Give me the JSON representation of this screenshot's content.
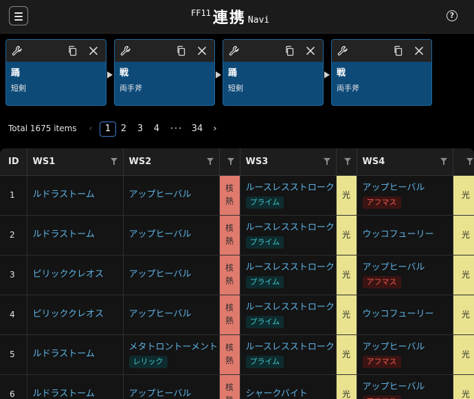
{
  "header": {
    "title_small": "FF11",
    "title_main": "連携",
    "title_suffix": "Navi",
    "menu_icon": "hamburger-icon",
    "help_icon": "help-circle-icon"
  },
  "cards": [
    {
      "main": "踊",
      "sub": "短剣"
    },
    {
      "main": "戦",
      "sub": "両手斧"
    },
    {
      "main": "踊",
      "sub": "短剣"
    },
    {
      "main": "戦",
      "sub": "両手斧"
    }
  ],
  "pagination": {
    "total": "Total 1675 items",
    "prev": "‹",
    "pages": [
      "1",
      "2",
      "3",
      "4"
    ],
    "ellipsis": "•••",
    "last": "34",
    "next": "›",
    "current": "1"
  },
  "table": {
    "headers": [
      "ID",
      "WS1",
      "WS2",
      "",
      "WS3",
      "",
      "WS4",
      ""
    ],
    "rows": [
      {
        "id": "1",
        "ws1": "ルドラストーム",
        "ws2": "アップヒーバル",
        "ws2_tag": "",
        "sc1": "核熱",
        "ws3": "ルースレスストローク",
        "ws3_tag": "プライム",
        "sc2": "光",
        "ws4": "アップヒーバル",
        "ws4_tag": "アフマス",
        "sc3": "光"
      },
      {
        "id": "2",
        "ws1": "ルドラストーム",
        "ws2": "アップヒーバル",
        "ws2_tag": "",
        "sc1": "核熱",
        "ws3": "ルースレスストローク",
        "ws3_tag": "プライム",
        "sc2": "光",
        "ws4": "ウッコフューリー",
        "ws4_tag": "",
        "sc3": "光"
      },
      {
        "id": "3",
        "ws1": "ピリッククレオス",
        "ws2": "アップヒーバル",
        "ws2_tag": "",
        "sc1": "核熱",
        "ws3": "ルースレスストローク",
        "ws3_tag": "プライム",
        "sc2": "光",
        "ws4": "アップヒーバル",
        "ws4_tag": "アフマス",
        "sc3": "光"
      },
      {
        "id": "4",
        "ws1": "ピリッククレオス",
        "ws2": "アップヒーバル",
        "ws2_tag": "",
        "sc1": "核熱",
        "ws3": "ルースレスストローク",
        "ws3_tag": "プライム",
        "sc2": "光",
        "ws4": "ウッコフューリー",
        "ws4_tag": "",
        "sc3": "光"
      },
      {
        "id": "5",
        "ws1": "ルドラストーム",
        "ws2": "メタトロントーメント",
        "ws2_tag": "レリック",
        "sc1": "核熱",
        "ws3": "ルースレスストローク",
        "ws3_tag": "プライム",
        "sc2": "光",
        "ws4": "アップヒーバル",
        "ws4_tag": "アフマス",
        "sc3": "光"
      },
      {
        "id": "6",
        "ws1": "ルドラストーム",
        "ws2": "アップヒーバル",
        "ws2_tag": "",
        "sc1": "核熱",
        "ws3": "シャークバイト",
        "ws3_tag": "",
        "sc2": "光",
        "ws4": "アップヒーバル",
        "ws4_tag": "アフマス",
        "sc3": "光"
      }
    ]
  },
  "colors": {
    "card_bg": "#0d4a78",
    "link": "#5eb4e6",
    "fusion": "#e07a6d",
    "light": "#e9e38f",
    "prime_tag": "#3fc6c6",
    "aftermath_tag": "#f05a4a",
    "active_page_border": "#3c7fd2"
  }
}
